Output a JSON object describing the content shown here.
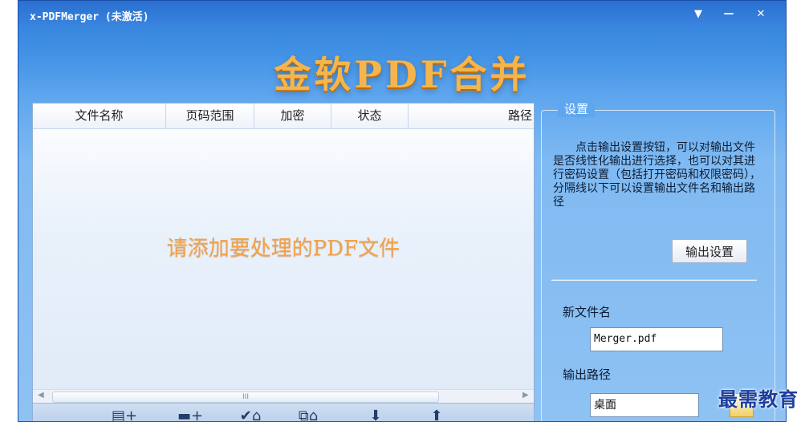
{
  "window": {
    "title": "x-PDFMerger (未激活)"
  },
  "titlebar_buttons": {
    "menu": "▼",
    "minimize": "—",
    "close": "✕"
  },
  "brand": "金软PDF合并",
  "file_list": {
    "columns": [
      "文件名称",
      "页码范围",
      "加密",
      "状态",
      "路径"
    ],
    "placeholder": "请添加要处理的PDF文件",
    "hscroll_thumb": "III"
  },
  "toolbar": {
    "items": [
      {
        "name": "add-file",
        "glyph": "▤+"
      },
      {
        "name": "add-folder",
        "glyph": "▬+"
      },
      {
        "name": "remove-selected",
        "glyph": "✔⌂"
      },
      {
        "name": "remove-all",
        "glyph": "⧉⌂"
      },
      {
        "name": "move-down",
        "glyph": "⬇"
      },
      {
        "name": "move-up",
        "glyph": "⬆"
      }
    ]
  },
  "settings": {
    "legend": "设置",
    "description": "点击输出设置按钮，可以对输出文件是否线性化输出进行选择，也可以对其进行密码设置（包括打开密码和权限密码），分隔线以下可以设置输出文件名和输出路径",
    "output_settings_button": "输出设置",
    "new_filename_label": "新文件名",
    "new_filename_value": "Merger.pdf",
    "output_path_label": "输出路径",
    "output_path_value": "桌面"
  },
  "watermark": "最需教育"
}
